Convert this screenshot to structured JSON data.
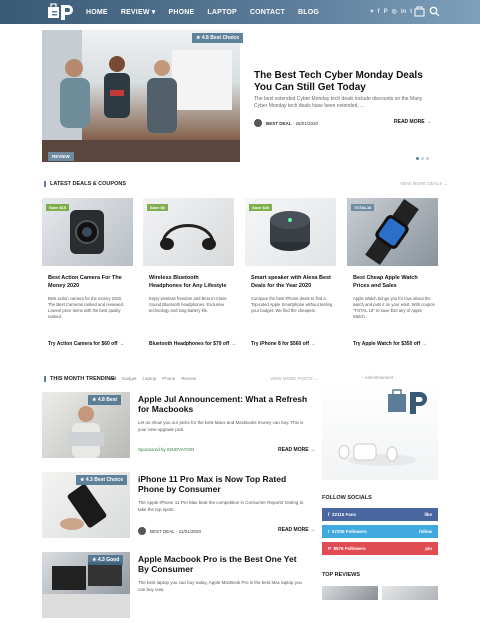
{
  "nav": {
    "items": [
      "HOME",
      "REVIEW ▾",
      "PHONE",
      "LAPTOP",
      "CONTACT",
      "BLOG"
    ],
    "social": [
      "♥",
      "f",
      "P",
      "◎",
      "in",
      "t"
    ]
  },
  "hero": {
    "rating": "4.8",
    "rating_label": "Best Choice",
    "category": "REVIEW",
    "title": "The Best Tech Cyber Monday Deals You Can Still Get Today",
    "excerpt": "The best extended Cyber Monday tech deals include discounts on the Many Cyber Monday tech deals have been extended, ...",
    "author": "BEST DEAL",
    "date": "26/01/2020",
    "read_more": "READ MORE →"
  },
  "deals": {
    "title": "LATEST DEALS & COUPONS",
    "view_more": "VIEW MORE DEALS →",
    "items": [
      {
        "price": "Save $10",
        "title": "Best Action Camera For The Money 2020",
        "desc": "Best action camera for the money 2020, The Best Cameras ranked and reviewed. Lowest price items with the best quality ranked.",
        "cta": "Try Action Camera for $60 off →",
        "bg": "linear-gradient(135deg,#e6e9ec,#b8bec4)"
      },
      {
        "price": "Save $6",
        "title": "Wireless Bluetooth Headphones for Any Lifestyle",
        "desc": "Enjoy wireless freedom and Best In-Class Sound Bluetooth headphones. Exclusive technology and long battery life.",
        "cta": "Bluetooth Headphones for $79 off →",
        "bg": "linear-gradient(135deg,#f2f3f4,#d7d9db)"
      },
      {
        "price": "Save $40",
        "title": "Smart speaker with Alexa Best Deals for the Year 2020",
        "desc": "Compare the best iPhone deals to find a Top-rated Apple Smartphone without testing your budget. We find the cheapest.",
        "cta": "Try iPhone 8 for $560 off →",
        "bg": "linear-gradient(135deg,#f5f6f7,#e1e4e6)"
      },
      {
        "price": "TOTAL10",
        "title": "Best Cheap Apple Watch Prices and Sales",
        "desc": "Apple Watch brings you for love about the watch and puts it on your wrist. With coupon \"TOTAL 10\" to save $10 any of Apple Watch.",
        "cta": "Try Apple Watch for $350 off →",
        "bg": "linear-gradient(135deg,#c9ced3,#8a939b)"
      }
    ]
  },
  "trending": {
    "title": "THIS MONTH TRENDING",
    "tabs": [
      "All",
      "Gadget",
      "Laptop",
      "Phone",
      "Review"
    ],
    "view_more": "VIEW MORE POSTS →",
    "items": [
      {
        "rating": "4.8",
        "rating_label": "Best",
        "title": "Apple Jul Announcement: What a Refresh for Macbooks",
        "desc": "Let us show you our picks for the best Macs and MacBooks money can buy. This is your new upgrade pick.",
        "meta": "Sponsored by INNOVATION",
        "read_more": "READ MORE →",
        "bg": "linear-gradient(135deg,#ececea,#b9b9b6)"
      },
      {
        "rating": "4.3",
        "rating_label": "Best Choice",
        "title": "iPhone 11 Pro Max is Now Top Rated Phone by Consumer",
        "desc": "The Apple iPhone 11 Pro Max beat the competition in Consumer Reports' testing to take the top spots.",
        "meta": "BEST DEAL · 21/01/2020",
        "read_more": "READ MORE →",
        "bg": "linear-gradient(135deg,#f4f4f2,#d9dbdc)"
      },
      {
        "rating": "4.3",
        "rating_label": "Good",
        "title": "Apple Macbook Pro is the Best One Yet By Consumer",
        "desc": "The best laptop you can buy today, Apple MacBook Pro is the best Mac laptop you can buy now.",
        "meta": "",
        "read_more": "",
        "bg": "linear-gradient(135deg,#d9dde0,#868e95)"
      }
    ]
  },
  "sidebar": {
    "ad_label": "- Advertisement -",
    "socials_title": "FOLLOW SOCIALS",
    "socials": [
      {
        "count": "22115 Fans",
        "action": "like",
        "color": "#4a66a0"
      },
      {
        "count": "67205 Followers",
        "action": "follow",
        "color": "#3fa9e0"
      },
      {
        "count": "8575 Followers",
        "action": "pin",
        "color": "#e14b52"
      }
    ],
    "top_reviews": "TOP REVIEWS"
  },
  "colors": {
    "accent": "#5e7e9c",
    "price": "#7fae4c"
  }
}
